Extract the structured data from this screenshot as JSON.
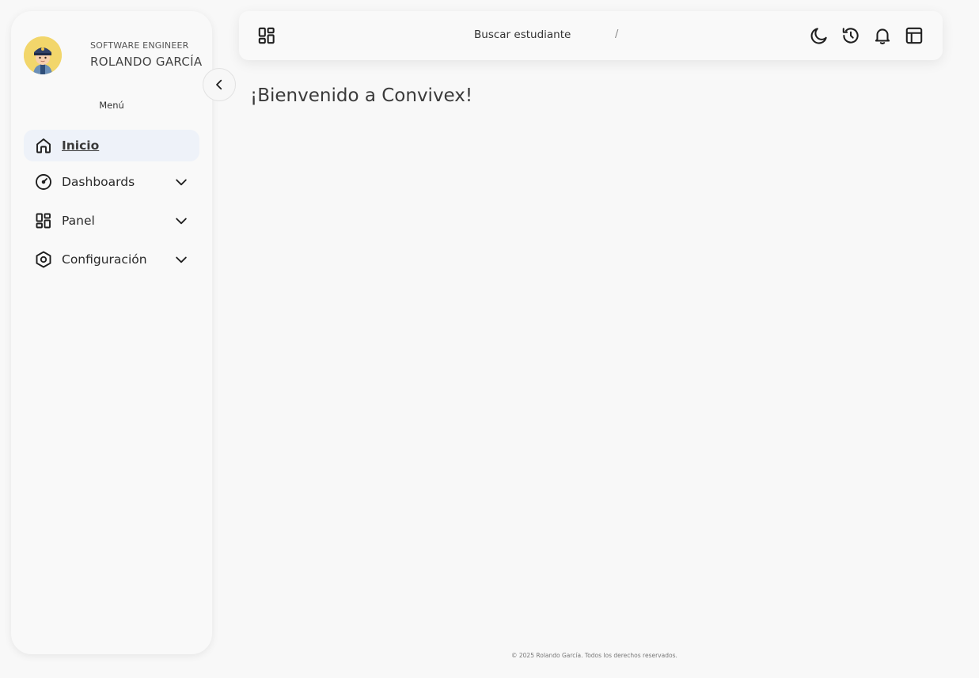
{
  "sidebar": {
    "profile": {
      "role": "SOFTWARE ENGINEER",
      "name": "ROLANDO GARCÍA",
      "avatar_icon": "avatar-police-cartoon"
    },
    "menu_label": "Menú",
    "items": [
      {
        "label": "Inicio",
        "icon": "home-icon",
        "active": true,
        "expandable": false
      },
      {
        "label": "Dashboards",
        "icon": "gauge-icon",
        "active": false,
        "expandable": true
      },
      {
        "label": "Panel",
        "icon": "grid-icon",
        "active": false,
        "expandable": true
      },
      {
        "label": "Configuración",
        "icon": "hexagon-settings-icon",
        "active": false,
        "expandable": true
      }
    ]
  },
  "topbar": {
    "search_label": "Buscar estudiante",
    "search_shortcut": "/",
    "icons": [
      "apps-grid-icon",
      "moon-icon",
      "history-icon",
      "bell-icon",
      "layout-icon"
    ]
  },
  "main": {
    "welcome": "¡Bienvenido a Convivex!"
  },
  "footer": {
    "copyright": "© 2025 Rolando García. Todos los derechos reservados."
  },
  "colors": {
    "background": "#f8f8f8",
    "active_item_bg": "#eef2f9",
    "avatar_bg": "#f2d66b"
  }
}
